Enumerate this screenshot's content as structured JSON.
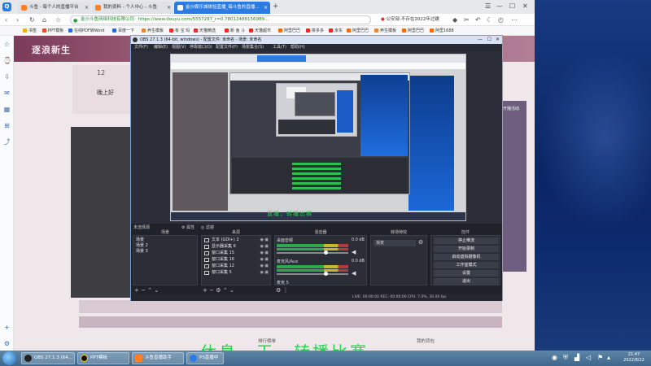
{
  "browser": {
    "tabs": [
      {
        "label": "斗鱼 - 每个人的直播平台"
      },
      {
        "label": "我的资料 - 个人中心 - 斗鱼"
      },
      {
        "label": "金沙娱乐城体验直播_每斗鱼的直播..."
      }
    ],
    "new_tab": "+",
    "address": {
      "site": "金沙斗鱼网络科技有限公司",
      "url": "https://www.douyu.com/5557287_r=0.78012488156989..."
    },
    "notice": "公安部:不存在2022年过建",
    "bookmarks": [
      "书签",
      "PPT模板",
      "在线PDF转Word",
      "百度一下",
      "养生模板",
      "有 宝 玛",
      "天猫精选",
      "新 鱼 斗",
      "天猫超市",
      "阿里巴巴",
      "拼多多",
      "京东",
      "阿里巴巴",
      "养生模板",
      "阿里巴巴",
      "阿里1688"
    ]
  },
  "page": {
    "banner_title": "逐浪新生",
    "room_number": "12",
    "greeting": "晚上好",
    "promo_text": "开播活动",
    "bottom_tab_1": "排行榜单",
    "bottom_tab_2": "我的背包"
  },
  "obs": {
    "title": "OBS 27.1.3 (64-bit, windows) - 配置文件: 未命名 - 场景: 未命名",
    "menu": [
      "文件(F)",
      "编辑(E)",
      "视图(V)",
      "停靠窗口(D)",
      "配置文件(P)",
      "场景集合(S)",
      "工具(T)",
      "帮助(H)"
    ],
    "preview_caption": "直播，转播比赛",
    "no_source": "未选择源",
    "properties": "属性",
    "filters": "滤镜",
    "docks": {
      "scenes": "场景",
      "sources": "来源",
      "mixer": "混音器",
      "transitions": "转场特效",
      "controls": "控件"
    },
    "scene_list": [
      "场景",
      "场景 2",
      "场景 3"
    ],
    "source_list": [
      "文本 (GDI+) 2",
      "显示器采集 6",
      "窗口采集 15",
      "窗口采集 16",
      "窗口采集 12",
      "窗口采集 5"
    ],
    "mixer": [
      {
        "name": "桌面音频",
        "db": "0.0 dB"
      },
      {
        "name": "麦克风/Aux",
        "db": "0.0 dB"
      }
    ],
    "mixer_extra": "麦克 5",
    "transition": "渐变",
    "controls": [
      "停止推流",
      "开始录制",
      "启动虚拟摄像机",
      "工作室模式",
      "设置",
      "退出"
    ],
    "status": "LIVE: 00:00:00    REC: 00:00:00    CPU: 7.0%, 30.00 fps"
  },
  "overlay_caption": "休息一天，转播比赛",
  "taskbar": {
    "items": [
      "OBS 27.1.3 (64...",
      "PPT模板",
      "斗鱼直播助手",
      "PS直播中"
    ],
    "time": "21:47",
    "date": "2022/8/22"
  },
  "colors": {
    "obs_bg": "#2b2e38",
    "caption_green": "#22d64c",
    "tab_active": "#2c7be0",
    "desktop_blue": "#0a2563"
  }
}
